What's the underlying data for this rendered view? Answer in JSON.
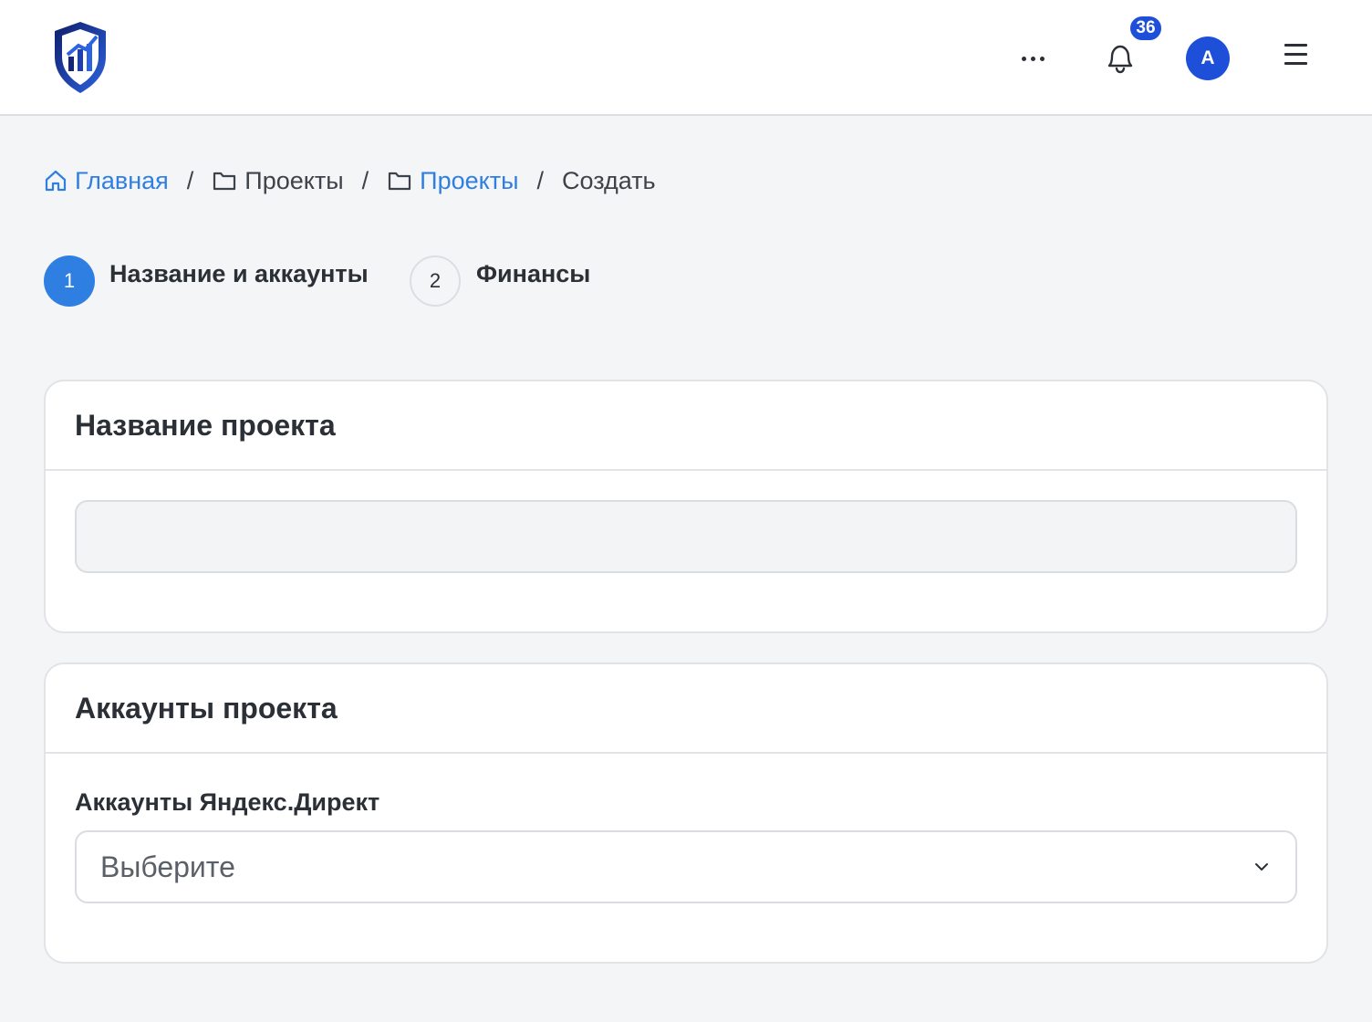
{
  "notifications": {
    "count": "36"
  },
  "user": {
    "initial": "A"
  },
  "breadcrumb": {
    "home": "Главная",
    "projects_parent": "Проекты",
    "projects": "Проекты",
    "current": "Создать",
    "separator": "/"
  },
  "steps": [
    {
      "number": "1",
      "label": "Название и аккаунты",
      "active": true
    },
    {
      "number": "2",
      "label": "Финансы",
      "active": false
    }
  ],
  "project_name_card": {
    "title": "Название проекта",
    "input_value": ""
  },
  "accounts_card": {
    "title": "Аккаунты проекта",
    "field_label": "Аккаунты Яндекс.Директ",
    "select_value": "Выберите"
  },
  "colors": {
    "primary": "#2f7fe3",
    "brand_dark": "#1d4fd8",
    "background": "#f4f5f7"
  }
}
